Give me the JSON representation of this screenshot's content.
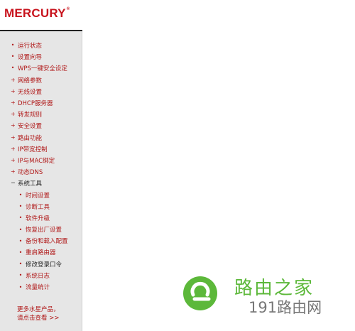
{
  "brand": {
    "logo_text": "MERCURY",
    "registered": "®"
  },
  "menu": {
    "items": [
      {
        "label": "运行状态",
        "marker": "•"
      },
      {
        "label": "设置向导",
        "marker": "•"
      },
      {
        "label": "WPS一键安全设定",
        "marker": "•"
      },
      {
        "label": "网络参数",
        "marker": "+"
      },
      {
        "label": "无线设置",
        "marker": "+"
      },
      {
        "label": "DHCP服务器",
        "marker": "+"
      },
      {
        "label": "转发规则",
        "marker": "+"
      },
      {
        "label": "安全设置",
        "marker": "+"
      },
      {
        "label": "路由功能",
        "marker": "+"
      },
      {
        "label": "IP带宽控制",
        "marker": "+"
      },
      {
        "label": "IP与MAC绑定",
        "marker": "+"
      },
      {
        "label": "动态DNS",
        "marker": "+"
      }
    ],
    "open_section": {
      "label": "系统工具",
      "marker": "−"
    },
    "subitems": [
      {
        "label": "时间设置",
        "marker": "•"
      },
      {
        "label": "诊断工具",
        "marker": "•"
      },
      {
        "label": "软件升级",
        "marker": "•"
      },
      {
        "label": "恢复出厂设置",
        "marker": "•"
      },
      {
        "label": "备份和载入配置",
        "marker": "•"
      },
      {
        "label": "重启路由器",
        "marker": "•"
      },
      {
        "label": "修改登录口令",
        "marker": "•"
      },
      {
        "label": "系统日志",
        "marker": "•"
      },
      {
        "label": "流量统计",
        "marker": "•"
      }
    ]
  },
  "more": {
    "line1": "更多水星产品，",
    "line2": "请点击查看 >>"
  },
  "watermark": {
    "title": "路由之家",
    "subtitle": "191路由网"
  },
  "colors": {
    "brand_red": "#c8141e",
    "menu_red": "#b01818",
    "watermark_green": "#5cb83a",
    "sidebar_bg": "#e6e6e6"
  }
}
